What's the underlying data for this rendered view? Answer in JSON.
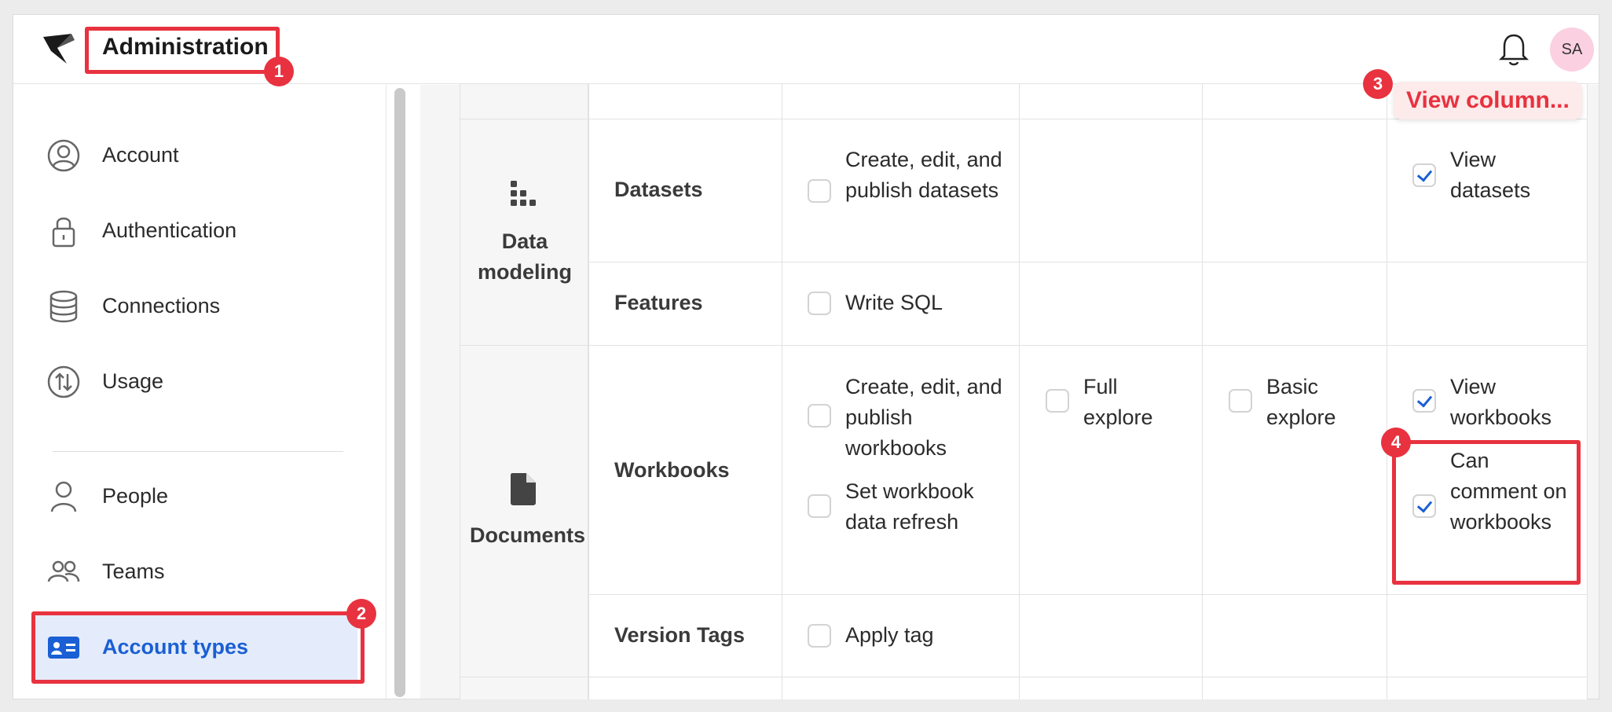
{
  "header": {
    "title": "Administration",
    "avatar_initials": "SA"
  },
  "sidebar": {
    "items": [
      {
        "label": "Account",
        "icon": "user-circle-icon"
      },
      {
        "label": "Authentication",
        "icon": "lock-icon"
      },
      {
        "label": "Connections",
        "icon": "database-icon"
      },
      {
        "label": "Usage",
        "icon": "usage-arrows-icon"
      },
      {
        "label": "People",
        "icon": "person-icon"
      },
      {
        "label": "Teams",
        "icon": "teams-icon"
      },
      {
        "label": "Account types",
        "icon": "id-card-icon",
        "active": true
      }
    ]
  },
  "table": {
    "categories": [
      {
        "label": "Data modeling",
        "icon": "data-modeling-icon"
      },
      {
        "label": "Documents",
        "icon": "document-icon"
      }
    ],
    "rows": {
      "datasets": {
        "label": "Datasets",
        "col1": {
          "text": "Create, edit, and publish datasets",
          "checked": false
        },
        "col4": {
          "text": "View datasets",
          "checked": true
        }
      },
      "features": {
        "label": "Features",
        "col1": {
          "text": "Write SQL",
          "checked": false
        }
      },
      "workbooks": {
        "label": "Workbooks",
        "col1a": {
          "text": "Create, edit, and publish workbooks",
          "checked": false
        },
        "col1b": {
          "text": "Set workbook data refresh",
          "checked": false
        },
        "col2": {
          "text": "Full explore",
          "checked": false
        },
        "col3": {
          "text": "Basic explore",
          "checked": false
        },
        "col4a": {
          "text": "View workbooks",
          "checked": true
        },
        "col4b": {
          "text": "Can comment on workbooks",
          "checked": true
        }
      },
      "version_tags": {
        "label": "Version Tags",
        "col1": {
          "text": "Apply tag",
          "checked": false
        }
      }
    }
  },
  "annotations": {
    "badge1": "1",
    "badge2": "2",
    "badge3": "3",
    "badge4": "4",
    "tooltip": "View column..."
  },
  "colors": {
    "accent": "#1a5fd4",
    "annotation": "#e8323f",
    "active_bg": "#e4ecfb"
  }
}
